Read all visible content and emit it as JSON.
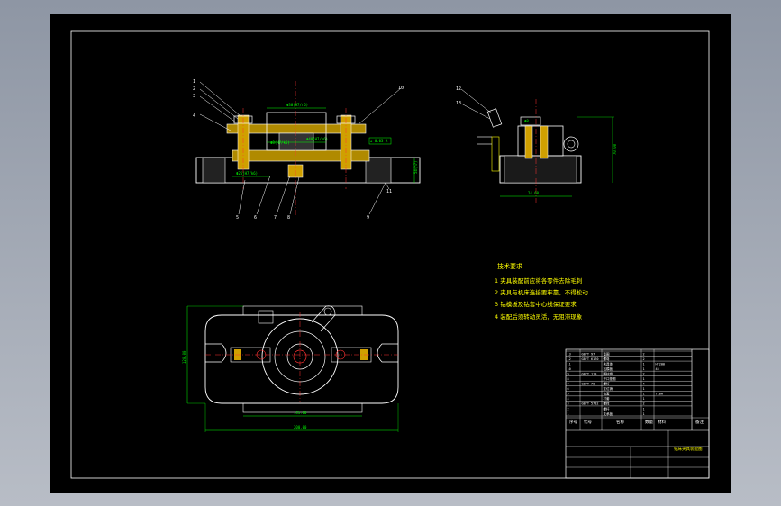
{
  "drawing": {
    "title": "钻床夹具装配图",
    "leaders": [
      "1",
      "2",
      "3",
      "4",
      "5",
      "6",
      "7",
      "8",
      "9",
      "10",
      "11",
      "12",
      "13"
    ],
    "dimensions": {
      "d1": "Φ8(H7/k6)",
      "d2": "Φ30(H7/r6)",
      "d3": "Φ25(H7/k6)",
      "d4": "Φ40(H7/n6)",
      "d5": "54(h7)",
      "d6": "Φ8",
      "d7": "24.60",
      "d8": "80.00",
      "d9": "70.00",
      "d10": "120.00",
      "d11": "145.00",
      "d12": "200.00",
      "tol": "⊥ 0.03 A"
    }
  },
  "notes": {
    "heading": "技术要求",
    "lines": [
      "1  夹具装配前应将各零件去除毛刺",
      "2  夹具与机床连接要牢靠，不得松动",
      "3  钻模板及钻套中心线保证要求",
      "4  装配后须转动灵活，无阻滞现象"
    ]
  },
  "title_block": {
    "drawing_name": "钻床夹具装配图",
    "headers": [
      "序号",
      "代号",
      "名称",
      "数量",
      "材料",
      "备注"
    ],
    "rows": [
      [
        "13",
        "GB/T 97",
        "垫圈",
        "2",
        "",
        ""
      ],
      [
        "12",
        "GB/T 6170",
        "螺母",
        "2",
        "",
        ""
      ],
      [
        "11",
        "",
        "夹具体",
        "1",
        "HT200",
        ""
      ],
      [
        "10",
        "",
        "钻模板",
        "1",
        "45",
        ""
      ],
      [
        "9",
        "GB/T 119",
        "圆柱销",
        "2",
        "",
        ""
      ],
      [
        "8",
        "",
        "开口垫圈",
        "1",
        "",
        ""
      ],
      [
        "7",
        "GB/T 70",
        "螺钉",
        "4",
        "",
        ""
      ],
      [
        "6",
        "",
        "定位销",
        "1",
        "",
        ""
      ],
      [
        "5",
        "",
        "钻套",
        "1",
        "T10A",
        ""
      ],
      [
        "4",
        "",
        "衬套",
        "1",
        "",
        ""
      ],
      [
        "3",
        "GB/T 5782",
        "螺栓",
        "2",
        "",
        ""
      ],
      [
        "2",
        "",
        "螺杆",
        "1",
        "",
        ""
      ],
      [
        "1",
        "",
        "支承板",
        "1",
        "",
        ""
      ]
    ]
  },
  "colors": {
    "sheet": "#000000",
    "outline": "#ffffff",
    "dimension": "#00ff00",
    "center": "#ff3333",
    "hatch": "#c8a000",
    "part": "#ffffff"
  }
}
